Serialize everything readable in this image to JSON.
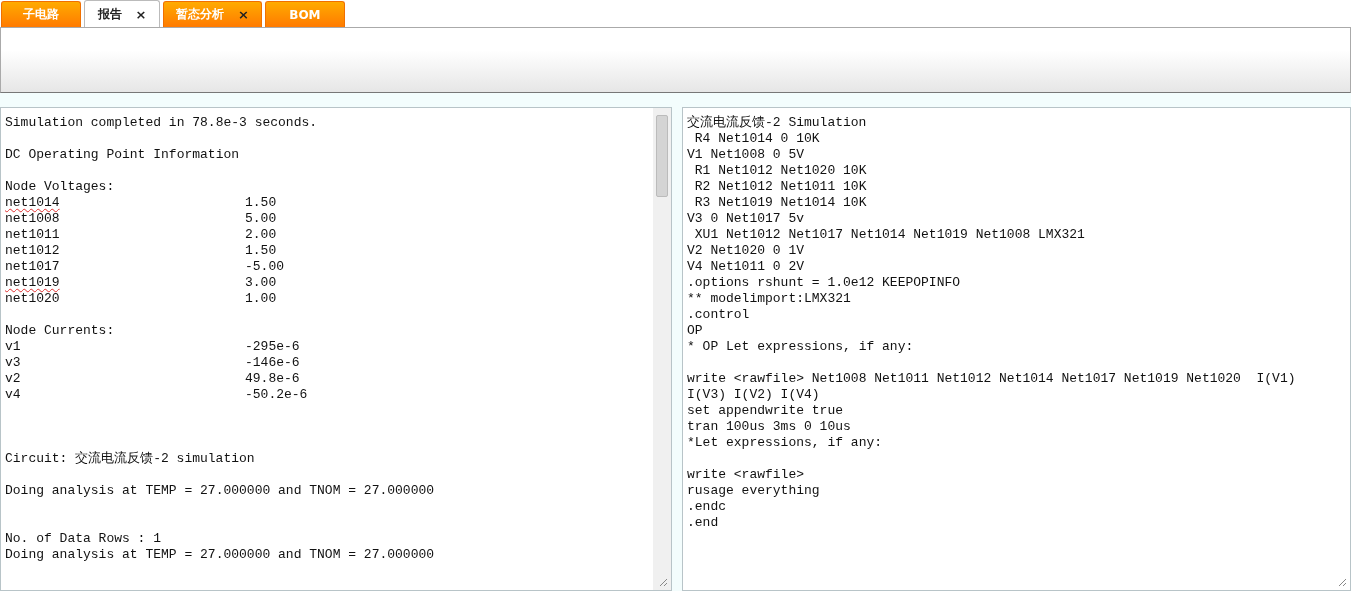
{
  "tabs": [
    {
      "label": "子电路",
      "selected": false,
      "closable": false
    },
    {
      "label": "报告",
      "selected": true,
      "closable": true
    },
    {
      "label": "暂态分析",
      "selected": false,
      "closable": true
    },
    {
      "label": "BOM",
      "selected": false,
      "closable": false
    }
  ],
  "close_glyph": "×",
  "report_output": {
    "lines": [
      {
        "kind": "text",
        "text": "Simulation completed in 78.8e-3 seconds."
      },
      {
        "kind": "blank"
      },
      {
        "kind": "text",
        "text": "DC Operating Point Information"
      },
      {
        "kind": "blank"
      },
      {
        "kind": "text",
        "text": "Node Voltages:"
      },
      {
        "kind": "pair",
        "name": "net1014",
        "value": "1.50",
        "flagged": true
      },
      {
        "kind": "pair",
        "name": "net1008",
        "value": "5.00",
        "flagged": false
      },
      {
        "kind": "pair",
        "name": "net1011",
        "value": "2.00",
        "flagged": false
      },
      {
        "kind": "pair",
        "name": "net1012",
        "value": "1.50",
        "flagged": false
      },
      {
        "kind": "pair",
        "name": "net1017",
        "value": "-5.00",
        "flagged": false
      },
      {
        "kind": "pair",
        "name": "net1019",
        "value": "3.00",
        "flagged": true
      },
      {
        "kind": "pair",
        "name": "net1020",
        "value": "1.00",
        "flagged": false
      },
      {
        "kind": "blank"
      },
      {
        "kind": "text",
        "text": "Node Currents:"
      },
      {
        "kind": "pair",
        "name": "v1",
        "value": "-295e-6",
        "flagged": false
      },
      {
        "kind": "pair",
        "name": "v3",
        "value": "-146e-6",
        "flagged": false
      },
      {
        "kind": "pair",
        "name": "v2",
        "value": "49.8e-6",
        "flagged": false
      },
      {
        "kind": "pair",
        "name": "v4",
        "value": "-50.2e-6",
        "flagged": false
      },
      {
        "kind": "blank"
      },
      {
        "kind": "blank"
      },
      {
        "kind": "blank"
      },
      {
        "kind": "text",
        "text": "Circuit: 交流电流反馈-2 simulation"
      },
      {
        "kind": "blank"
      },
      {
        "kind": "text",
        "text": "Doing analysis at TEMP = 27.000000 and TNOM = 27.000000"
      },
      {
        "kind": "blank"
      },
      {
        "kind": "blank"
      },
      {
        "kind": "text",
        "text": "No. of Data Rows : 1"
      },
      {
        "kind": "text",
        "text": "Doing analysis at TEMP = 27.000000 and TNOM = 27.000000"
      }
    ]
  },
  "netlist": {
    "lines": [
      {
        "kind": "text",
        "text": "交流电流反馈-2 Simulation"
      },
      {
        "kind": "text",
        "text": " R4 Net1014 0 10K"
      },
      {
        "kind": "text",
        "text": "V1 Net1008 0 5V"
      },
      {
        "kind": "text",
        "text": " R1 Net1012 Net1020 10K"
      },
      {
        "kind": "text",
        "text": " R2 Net1012 Net1011 10K"
      },
      {
        "kind": "text",
        "text": " R3 Net1019 Net1014 10K"
      },
      {
        "kind": "text",
        "text": "V3 0 Net1017 5v"
      },
      {
        "kind": "text",
        "text": " XU1 Net1012 Net1017 Net1014 Net1019 Net1008 LMX321"
      },
      {
        "kind": "text",
        "text": "V2 Net1020 0 1V"
      },
      {
        "kind": "text",
        "text": "V4 Net1011 0 2V"
      },
      {
        "kind": "text",
        "text": ".options rshunt = 1.0e12 KEEPOPINFO"
      },
      {
        "kind": "text",
        "text": "** modelimport:LMX321"
      },
      {
        "kind": "text",
        "text": ".control"
      },
      {
        "kind": "text",
        "text": "OP"
      },
      {
        "kind": "text",
        "text": "* OP Let expressions, if any:"
      },
      {
        "kind": "blank"
      },
      {
        "kind": "text",
        "text": "write <rawfile> Net1008 Net1011 Net1012 Net1014 Net1017 Net1019 Net1020  I(V1)"
      },
      {
        "kind": "text",
        "text": "I(V3) I(V2) I(V4)"
      },
      {
        "kind": "text",
        "text": "set appendwrite true"
      },
      {
        "kind": "text",
        "text": "tran 100us 3ms 0 10us"
      },
      {
        "kind": "text",
        "text": "*Let expressions, if any:"
      },
      {
        "kind": "blank"
      },
      {
        "kind": "text",
        "text": "write <rawfile>"
      },
      {
        "kind": "text",
        "text": "rusage everything"
      },
      {
        "kind": "text",
        "text": ".endc"
      },
      {
        "kind": "text",
        "text": ".end"
      }
    ]
  }
}
